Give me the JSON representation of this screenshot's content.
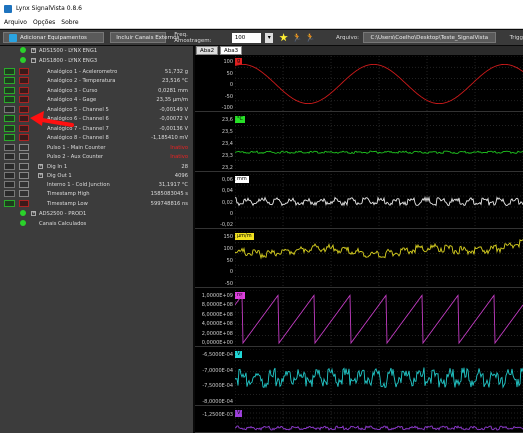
{
  "window": {
    "title": "Lynx SignalVista 0.8.6"
  },
  "menu": [
    "Arquivo",
    "Opções",
    "Sobre"
  ],
  "toolbar": {
    "add_button": "Adicionar Equipamentos",
    "external_button": "Incluir Canais Externos",
    "freq_label": "Freq. Amostragem:",
    "freq_value": "100",
    "file_label": "Arquivo:",
    "file_path": "C:\\Users\\Coelho\\Desktop\\Teste_SignalVista",
    "trigger_label": "Trigg"
  },
  "channels": [
    {
      "label": "ADS1500 - LYNX ENG1",
      "value": ""
    },
    {
      "label": "ADS1800 - LYNX ENG3",
      "value": ""
    },
    {
      "label": "Analógico 1 - Acelerometro",
      "value": "51,732 g"
    },
    {
      "label": "Analógico 2 - Temperatura",
      "value": "23,516 °C"
    },
    {
      "label": "Analógico 3 - Curso",
      "value": "0,0281 mm"
    },
    {
      "label": "Analógico 4 - Gage",
      "value": "23,35 µm/m"
    },
    {
      "label": "Analógico 5 - Channel 5",
      "value": "-0,00149 V"
    },
    {
      "label": "Analógico 6 - Channel 6",
      "value": "-0,00072 V"
    },
    {
      "label": "Analógico 7 - Channel 7",
      "value": "-0,00136 V"
    },
    {
      "label": "Analógico 8 - Channel 8",
      "value": "-1,185410 mV"
    },
    {
      "label": "Pulso 1 - Main Counter",
      "value": "Inativo"
    },
    {
      "label": "Pulso 2 - Aux Counter",
      "value": "Inativo"
    },
    {
      "label": "Dig In 1",
      "value": "28"
    },
    {
      "label": "Dig Out 1",
      "value": "4096"
    },
    {
      "label": "Interno 1 - Cold Junction",
      "value": "31,1917 °C"
    },
    {
      "label": "Timestamp High",
      "value": "1585083045 s"
    },
    {
      "label": "Timestamp Low",
      "value": "599748816 ns"
    },
    {
      "label": "ADS2500 - PROD1",
      "value": ""
    },
    {
      "label": "Canais Calculados",
      "value": ""
    }
  ],
  "tabs": [
    "Aba2",
    "Aba3"
  ],
  "plots": [
    {
      "tag": "g",
      "tag_color": "#e02020",
      "line_color": "#cc1a1a",
      "ticks": [
        "100",
        "50",
        "0",
        "-50",
        "-100"
      ]
    },
    {
      "tag": "°C",
      "tag_color": "#27e027",
      "line_color": "#1fbf1f",
      "ticks": [
        "23,6",
        "23,5",
        "23,4",
        "23,3",
        "23,2"
      ]
    },
    {
      "tag": "mm",
      "tag_color": "#ffffff",
      "line_color": "#e8e8e8",
      "ticks": [
        "0,06",
        "0,04",
        "0,02",
        "0",
        "-0,02"
      ]
    },
    {
      "tag": "µm/m",
      "tag_color": "#f0e020",
      "line_color": "#d8d020",
      "ticks": [
        "150",
        "100",
        "50",
        "0",
        "-50"
      ]
    },
    {
      "tag": "ns",
      "tag_color": "#e040e0",
      "line_color": "#c23cc2",
      "ticks": [
        "1,0000E+09",
        "8,0000E+08",
        "6,0000E+08",
        "4,0000E+08",
        "2,0000E+08",
        "0,0000E+00"
      ]
    },
    {
      "tag": "V",
      "tag_color": "#20d8d8",
      "line_color": "#22c8c8",
      "ticks": [
        "-6,5000E-04",
        "-7,0000E-04",
        "-7,5000E-04",
        "-8,0000E-04"
      ]
    },
    {
      "tag": "V",
      "tag_color": "#a040e0",
      "line_color": "#8f3ad0",
      "ticks": [
        "-1,2500E-03"
      ]
    }
  ]
}
